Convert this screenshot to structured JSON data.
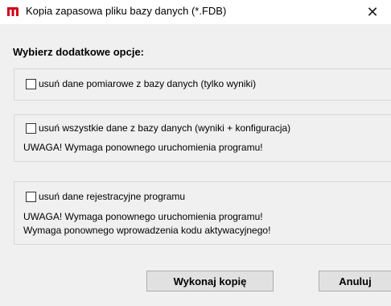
{
  "window": {
    "title": "Kopia zapasowa pliku bazy danych (*.FDB)",
    "close_glyph": "✕",
    "app_icon": "m-logo-icon",
    "accent_color": "#d0021b"
  },
  "heading": "Wybierz dodatkowe opcje:",
  "options": [
    {
      "label": "usuń dane pomiarowe z bazy danych (tylko wyniki)",
      "checked": false,
      "warnings": []
    },
    {
      "label": "usuń wszystkie dane z bazy danych (wyniki + konfiguracja)",
      "checked": false,
      "warnings": [
        "UWAGA! Wymaga ponownego uruchomienia programu!"
      ]
    },
    {
      "label": "usuń dane rejestracyjne programu",
      "checked": false,
      "warnings": [
        "UWAGA! Wymaga ponownego uruchomienia programu!",
        "Wymaga ponownego wprowadzenia kodu aktywacyjnego!"
      ]
    }
  ],
  "buttons": {
    "run": "Wykonaj kopię",
    "cancel": "Anuluj"
  }
}
